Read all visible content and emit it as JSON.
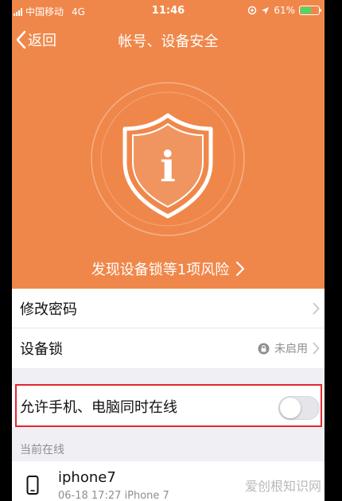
{
  "status_bar": {
    "carrier": "中国移动",
    "network": "4G",
    "time": "11:46",
    "battery_percent": "61%",
    "battery_level": 0.61
  },
  "nav": {
    "back_label": "返回",
    "title": "帐号、设备安全"
  },
  "hero": {
    "risk_text": "发现设备锁等1项风险",
    "shield_glyph": "i"
  },
  "list": {
    "change_password": "修改密码",
    "device_lock": "设备锁",
    "device_lock_status": "未启用"
  },
  "online_toggle": {
    "label": "允许手机、电脑同时在线",
    "enabled": false
  },
  "current_online": {
    "section_label": "当前在线",
    "device_name": "iphone7",
    "device_meta": "06-18 17:27  iPhone 7"
  },
  "watermark": "爱创根知识网",
  "colors": {
    "accent": "#f0874a",
    "highlight": "#e0282e"
  },
  "icons": [
    "back-chevron-icon",
    "shield-info-icon",
    "chevron-right-icon",
    "lock-icon",
    "phone-icon"
  ]
}
